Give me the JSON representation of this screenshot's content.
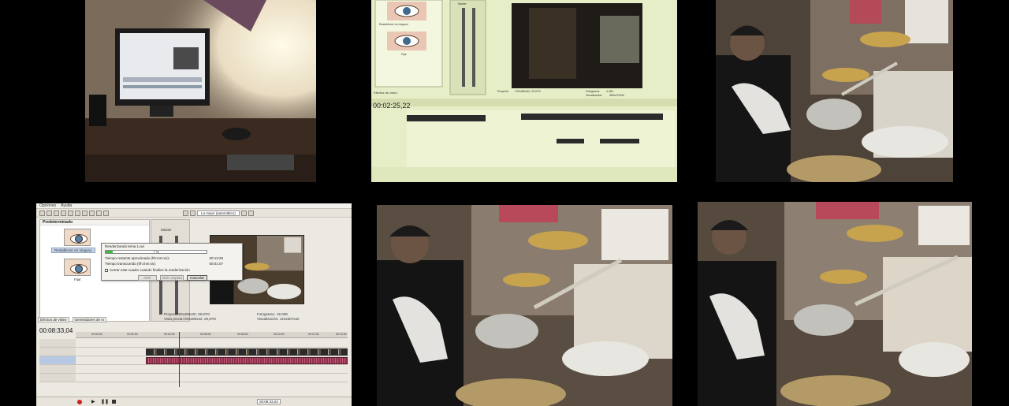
{
  "editor": {
    "menu": [
      "Opciones",
      "Ayuda"
    ],
    "quality": "La mejor (automático)",
    "fx_header": "Predeterminado",
    "preset_reset": "Restablecer en ninguno",
    "preset_fix": "Fijar",
    "dialog": {
      "title": "Renderizando tema 1.avi",
      "percent": "7 %",
      "progress": 0.07,
      "remaining_label": "Tiempo restante aproximado (hh:mm:ss):",
      "remaining_value": "00:13:29",
      "elapsed_label": "Tiempo transcurrido (hh:mm:ss):",
      "elapsed_value": "00:01:07",
      "close_check": "Cerrar este cuadro cuando finalice la renderización",
      "btn_open": "Abrir",
      "btn_open_folder": "Abrir carpeta",
      "btn_cancel": "Cancelar"
    },
    "mixer_label": "Master",
    "project_label": "Proyecto:",
    "project_value": "720x480x32; 29,970i",
    "preview_label": "Vista previa:",
    "preview_value": "720x480x32; 29,970i",
    "frame_label": "Fotograma:",
    "frame_value": "15.028",
    "display_label": "Visualización:",
    "display_value": "410x307x32",
    "tab_fx": "Efectos de vídeo",
    "tab_gen": "Generadores de m",
    "timecode": "00:08:33,04",
    "status_time": "00:08:33,04",
    "ruler": [
      "00:00:00",
      "00:02:00",
      "00:04:00",
      "00:06:00",
      "00:08:00",
      "00:10:00",
      "00:12:00",
      "00:14:00"
    ]
  },
  "monitor": {
    "fx_tab": "Efectos de vídeo",
    "timecode": "00:02:25,22",
    "preset": "Restablecer en ninguno",
    "preset2": "Fijar",
    "mixer": "Master",
    "project": "720x480x32; 29,970i",
    "frame": "4.460",
    "display": "360x270x32",
    "frame_label": "Fotograma:",
    "display_label": "Visualización:",
    "project_label": "Proyecto:"
  }
}
